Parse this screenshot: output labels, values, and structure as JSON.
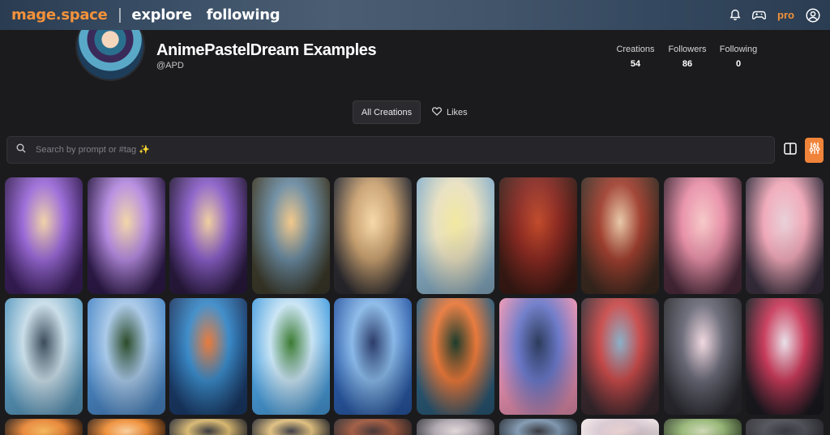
{
  "header": {
    "logo": "mage.space",
    "separator": "|",
    "nav": [
      "explore",
      "following"
    ],
    "pro_label": "pro",
    "icons": [
      "bell-icon",
      "gamepad-icon",
      "user-circle-icon"
    ]
  },
  "profile": {
    "name": "AnimePastelDream Examples",
    "handle": "@APD",
    "stats": [
      {
        "label": "Creations",
        "value": "54"
      },
      {
        "label": "Followers",
        "value": "86"
      },
      {
        "label": "Following",
        "value": "0"
      }
    ]
  },
  "tabs": {
    "all_creations": "All Creations",
    "likes": "Likes"
  },
  "search": {
    "placeholder": "Search by prompt or #tag ✨"
  },
  "colors": {
    "accent": "#f0843a",
    "background": "#1b1b1d"
  },
  "gallery": {
    "rows": [
      [
        {
          "c1": "#3a1f5c",
          "c2": "#9a6ad8",
          "c3": "#f0d2a8"
        },
        {
          "c1": "#2e1a4a",
          "c2": "#b48ae0",
          "c3": "#f2d6a8"
        },
        {
          "c1": "#2a1a40",
          "c2": "#8a5fc8",
          "c3": "#efcfa0"
        },
        {
          "c1": "#3c3a2a",
          "c2": "#6a8aa0",
          "c3": "#f2c88a"
        },
        {
          "c1": "#2a2a30",
          "c2": "#c8a070",
          "c3": "#f6d8a8"
        },
        {
          "c1": "#8ab0c8",
          "c2": "#e8e0c0",
          "c3": "#f2e8a0"
        },
        {
          "c1": "#3a1a14",
          "c2": "#8a2a22",
          "c3": "#c04a2a"
        },
        {
          "c1": "#3c2a20",
          "c2": "#a04030",
          "c3": "#e8c8a8"
        },
        {
          "c1": "#4a2a3a",
          "c2": "#e890a8",
          "c3": "#f6c8c8"
        },
        {
          "c1": "#3a3040",
          "c2": "#f0a8b8",
          "c3": "#e8d0d8"
        }
      ],
      [
        {
          "c1": "#5a9ac0",
          "c2": "#c8dde8",
          "c3": "#3a4a5a"
        },
        {
          "c1": "#4a88c8",
          "c2": "#a8c8e8",
          "c3": "#2a4a28"
        },
        {
          "c1": "#1a3a68",
          "c2": "#3a8ac8",
          "c3": "#e87a3a"
        },
        {
          "c1": "#4aa0e0",
          "c2": "#c8e4f4",
          "c3": "#3a7a30"
        },
        {
          "c1": "#2a5aa8",
          "c2": "#88b8e8",
          "c3": "#2a3a68"
        },
        {
          "c1": "#2a5a78",
          "c2": "#e8783a",
          "c3": "#1a3a2a"
        },
        {
          "c1": "#e890b0",
          "c2": "#6a78c8",
          "c3": "#2a3a5a"
        },
        {
          "c1": "#3a2a30",
          "c2": "#c84a4a",
          "c3": "#8ab0c8"
        },
        {
          "c1": "#2a2a30",
          "c2": "#6a6a78",
          "c3": "#f0d8e0"
        },
        {
          "c1": "#1a1a20",
          "c2": "#c83a5a",
          "c3": "#e8e0e8"
        }
      ],
      [
        {
          "c1": "#2a1a10",
          "c2": "#e8883a",
          "c3": "#f4b860"
        },
        {
          "c1": "#3a2010",
          "c2": "#f0903a",
          "c3": "#f8d0a0"
        },
        {
          "c1": "#2a2a30",
          "c2": "#d8b870",
          "c3": "#3a3a40"
        },
        {
          "c1": "#2a2a2e",
          "c2": "#e0c080",
          "c3": "#404048"
        },
        {
          "c1": "#30282a",
          "c2": "#a05a40",
          "c3": "#48383a"
        },
        {
          "c1": "#3a3a40",
          "c2": "#b0a8b0",
          "c3": "#e0d8d8"
        },
        {
          "c1": "#28303a",
          "c2": "#8098b0",
          "c3": "#3a3a40"
        },
        {
          "c1": "#f0e8e8",
          "c2": "#d8c8d0",
          "c3": "#e8d0d0"
        },
        {
          "c1": "#3a4a30",
          "c2": "#98b878",
          "c3": "#d0d8b8"
        },
        {
          "c1": "#2a2a30",
          "c2": "#505058",
          "c3": "#383840"
        }
      ]
    ]
  }
}
